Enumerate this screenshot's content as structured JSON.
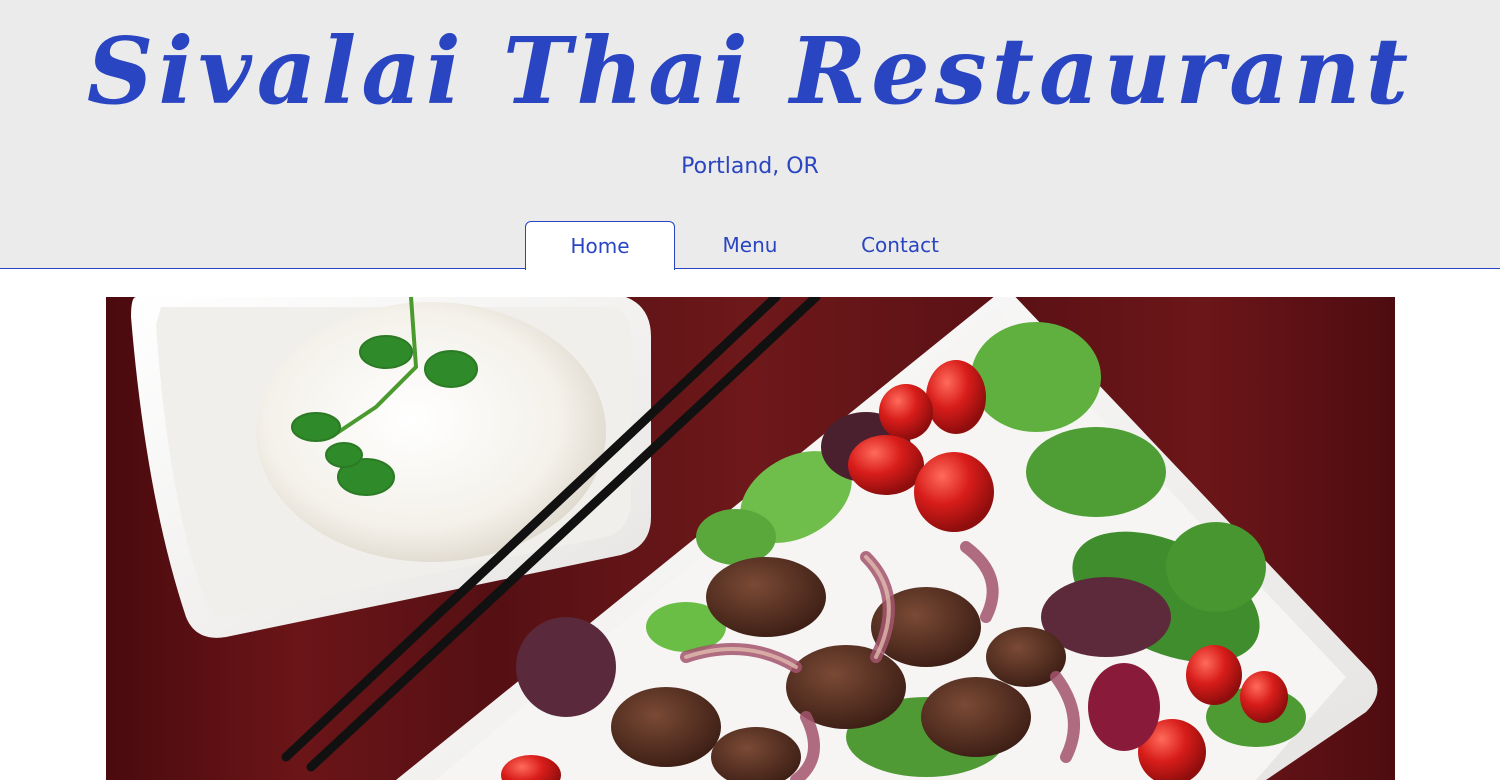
{
  "header": {
    "title": "Sivalai Thai Restaurant",
    "subtitle": "Portland, OR"
  },
  "nav": {
    "tabs": [
      {
        "label": "Home",
        "active": true
      },
      {
        "label": "Menu",
        "active": false
      },
      {
        "label": "Contact",
        "active": false
      }
    ]
  },
  "colors": {
    "accent": "#2a45c2",
    "header_bg": "#ebebeb",
    "table_wood": "#5e0d11"
  },
  "hero": {
    "image_subject": "thai-beef-salad-with-rice-and-chopsticks"
  }
}
